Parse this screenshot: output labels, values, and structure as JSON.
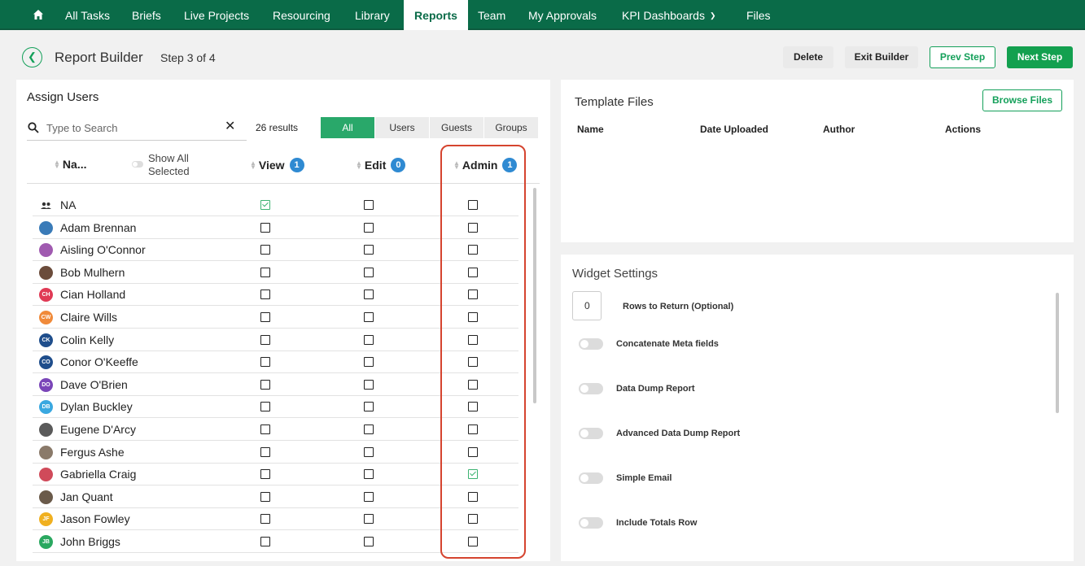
{
  "nav": {
    "items": [
      "All Tasks",
      "Briefs",
      "Live Projects",
      "Resourcing",
      "Library",
      "Reports",
      "Team",
      "My Approvals",
      "KPI Dashboards",
      "Files"
    ],
    "active": "Reports"
  },
  "header": {
    "title": "Report Builder",
    "step": "Step 3 of 4",
    "delete_label": "Delete",
    "exit_label": "Exit Builder",
    "prev_label": "Prev Step",
    "next_label": "Next Step"
  },
  "assign": {
    "title": "Assign Users",
    "search_placeholder": "Type to Search",
    "results": "26 results",
    "filters": [
      "All",
      "Users",
      "Guests",
      "Groups"
    ],
    "active_filter": "All",
    "columns": {
      "name": "Na...",
      "show_all": "Show All",
      "selected": "Selected",
      "view": "View",
      "view_count": "1",
      "edit": "Edit",
      "edit_count": "0",
      "admin": "Admin",
      "admin_count": "1"
    },
    "users": [
      {
        "name": "NA",
        "initials": "",
        "color": "#ffffff",
        "group": true,
        "view": true,
        "edit": false,
        "admin": false
      },
      {
        "name": "Adam Brennan",
        "initials": "",
        "color": "#3a7bb8",
        "view": false,
        "edit": false,
        "admin": false
      },
      {
        "name": "Aisling O'Connor",
        "initials": "",
        "color": "#a05ab0",
        "view": false,
        "edit": false,
        "admin": false
      },
      {
        "name": "Bob Mulhern",
        "initials": "",
        "color": "#6b4c3b",
        "view": false,
        "edit": false,
        "admin": false
      },
      {
        "name": "Cian Holland",
        "initials": "CH",
        "color": "#e03a55",
        "view": false,
        "edit": false,
        "admin": false
      },
      {
        "name": "Claire Wills",
        "initials": "CW",
        "color": "#f08a3a",
        "view": false,
        "edit": false,
        "admin": false
      },
      {
        "name": "Colin Kelly",
        "initials": "CK",
        "color": "#1f4e8c",
        "view": false,
        "edit": false,
        "admin": false
      },
      {
        "name": "Conor O'Keeffe",
        "initials": "CO",
        "color": "#1f4e8c",
        "view": false,
        "edit": false,
        "admin": false
      },
      {
        "name": "Dave O'Brien",
        "initials": "DO",
        "color": "#7a45b8",
        "view": false,
        "edit": false,
        "admin": false
      },
      {
        "name": "Dylan Buckley",
        "initials": "DB",
        "color": "#3aa8e0",
        "view": false,
        "edit": false,
        "admin": false
      },
      {
        "name": "Eugene D'Arcy",
        "initials": "",
        "color": "#5a5a5a",
        "view": false,
        "edit": false,
        "admin": false
      },
      {
        "name": "Fergus Ashe",
        "initials": "",
        "color": "#8a7a6a",
        "view": false,
        "edit": false,
        "admin": false
      },
      {
        "name": "Gabriella Craig",
        "initials": "",
        "color": "#d04a5a",
        "view": false,
        "edit": false,
        "admin": true
      },
      {
        "name": "Jan Quant",
        "initials": "",
        "color": "#6a5a4a",
        "view": false,
        "edit": false,
        "admin": false
      },
      {
        "name": "Jason Fowley",
        "initials": "JF",
        "color": "#f0b020",
        "view": false,
        "edit": false,
        "admin": false
      },
      {
        "name": "John Briggs",
        "initials": "JB",
        "color": "#2aa860",
        "view": false,
        "edit": false,
        "admin": false
      }
    ]
  },
  "template_files": {
    "title": "Template Files",
    "browse_label": "Browse Files",
    "columns": [
      "Name",
      "Date Uploaded",
      "Author",
      "Actions"
    ]
  },
  "widget_settings": {
    "title": "Widget Settings",
    "rows_value": "0",
    "rows_label": "Rows to Return (Optional)",
    "toggles": [
      "Concatenate Meta fields",
      "Data Dump Report",
      "Advanced Data Dump Report",
      "Simple Email",
      "Include Totals Row"
    ]
  },
  "colors": {
    "nav_bg": "#0a6b48",
    "accent": "#13a04f",
    "badge": "#2f8ad2",
    "highlight": "#d5442f"
  }
}
